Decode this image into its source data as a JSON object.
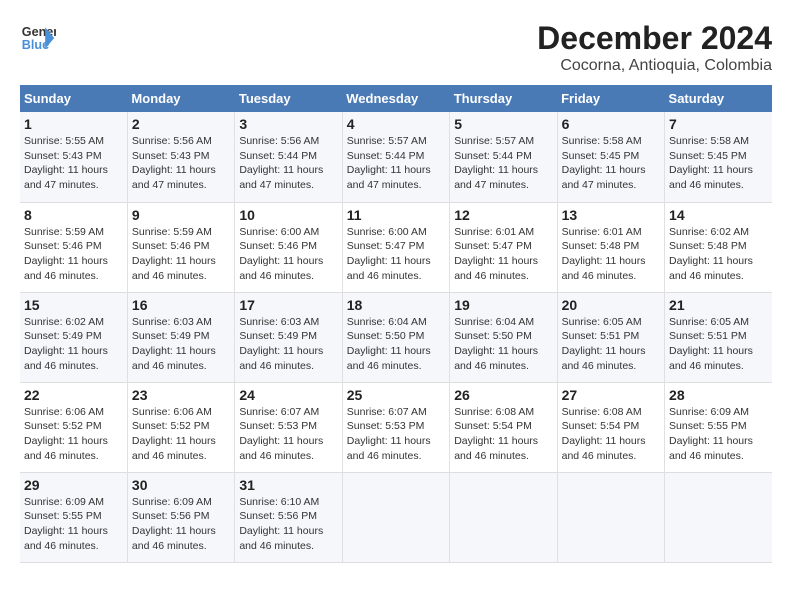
{
  "header": {
    "logo_line1": "General",
    "logo_line2": "Blue",
    "title": "December 2024",
    "subtitle": "Cocorna, Antioquia, Colombia"
  },
  "days_of_week": [
    "Sunday",
    "Monday",
    "Tuesday",
    "Wednesday",
    "Thursday",
    "Friday",
    "Saturday"
  ],
  "weeks": [
    [
      {
        "day": "1",
        "info": "Sunrise: 5:55 AM\nSunset: 5:43 PM\nDaylight: 11 hours and 47 minutes."
      },
      {
        "day": "2",
        "info": "Sunrise: 5:56 AM\nSunset: 5:43 PM\nDaylight: 11 hours and 47 minutes."
      },
      {
        "day": "3",
        "info": "Sunrise: 5:56 AM\nSunset: 5:44 PM\nDaylight: 11 hours and 47 minutes."
      },
      {
        "day": "4",
        "info": "Sunrise: 5:57 AM\nSunset: 5:44 PM\nDaylight: 11 hours and 47 minutes."
      },
      {
        "day": "5",
        "info": "Sunrise: 5:57 AM\nSunset: 5:44 PM\nDaylight: 11 hours and 47 minutes."
      },
      {
        "day": "6",
        "info": "Sunrise: 5:58 AM\nSunset: 5:45 PM\nDaylight: 11 hours and 47 minutes."
      },
      {
        "day": "7",
        "info": "Sunrise: 5:58 AM\nSunset: 5:45 PM\nDaylight: 11 hours and 46 minutes."
      }
    ],
    [
      {
        "day": "8",
        "info": "Sunrise: 5:59 AM\nSunset: 5:46 PM\nDaylight: 11 hours and 46 minutes."
      },
      {
        "day": "9",
        "info": "Sunrise: 5:59 AM\nSunset: 5:46 PM\nDaylight: 11 hours and 46 minutes."
      },
      {
        "day": "10",
        "info": "Sunrise: 6:00 AM\nSunset: 5:46 PM\nDaylight: 11 hours and 46 minutes."
      },
      {
        "day": "11",
        "info": "Sunrise: 6:00 AM\nSunset: 5:47 PM\nDaylight: 11 hours and 46 minutes."
      },
      {
        "day": "12",
        "info": "Sunrise: 6:01 AM\nSunset: 5:47 PM\nDaylight: 11 hours and 46 minutes."
      },
      {
        "day": "13",
        "info": "Sunrise: 6:01 AM\nSunset: 5:48 PM\nDaylight: 11 hours and 46 minutes."
      },
      {
        "day": "14",
        "info": "Sunrise: 6:02 AM\nSunset: 5:48 PM\nDaylight: 11 hours and 46 minutes."
      }
    ],
    [
      {
        "day": "15",
        "info": "Sunrise: 6:02 AM\nSunset: 5:49 PM\nDaylight: 11 hours and 46 minutes."
      },
      {
        "day": "16",
        "info": "Sunrise: 6:03 AM\nSunset: 5:49 PM\nDaylight: 11 hours and 46 minutes."
      },
      {
        "day": "17",
        "info": "Sunrise: 6:03 AM\nSunset: 5:49 PM\nDaylight: 11 hours and 46 minutes."
      },
      {
        "day": "18",
        "info": "Sunrise: 6:04 AM\nSunset: 5:50 PM\nDaylight: 11 hours and 46 minutes."
      },
      {
        "day": "19",
        "info": "Sunrise: 6:04 AM\nSunset: 5:50 PM\nDaylight: 11 hours and 46 minutes."
      },
      {
        "day": "20",
        "info": "Sunrise: 6:05 AM\nSunset: 5:51 PM\nDaylight: 11 hours and 46 minutes."
      },
      {
        "day": "21",
        "info": "Sunrise: 6:05 AM\nSunset: 5:51 PM\nDaylight: 11 hours and 46 minutes."
      }
    ],
    [
      {
        "day": "22",
        "info": "Sunrise: 6:06 AM\nSunset: 5:52 PM\nDaylight: 11 hours and 46 minutes."
      },
      {
        "day": "23",
        "info": "Sunrise: 6:06 AM\nSunset: 5:52 PM\nDaylight: 11 hours and 46 minutes."
      },
      {
        "day": "24",
        "info": "Sunrise: 6:07 AM\nSunset: 5:53 PM\nDaylight: 11 hours and 46 minutes."
      },
      {
        "day": "25",
        "info": "Sunrise: 6:07 AM\nSunset: 5:53 PM\nDaylight: 11 hours and 46 minutes."
      },
      {
        "day": "26",
        "info": "Sunrise: 6:08 AM\nSunset: 5:54 PM\nDaylight: 11 hours and 46 minutes."
      },
      {
        "day": "27",
        "info": "Sunrise: 6:08 AM\nSunset: 5:54 PM\nDaylight: 11 hours and 46 minutes."
      },
      {
        "day": "28",
        "info": "Sunrise: 6:09 AM\nSunset: 5:55 PM\nDaylight: 11 hours and 46 minutes."
      }
    ],
    [
      {
        "day": "29",
        "info": "Sunrise: 6:09 AM\nSunset: 5:55 PM\nDaylight: 11 hours and 46 minutes."
      },
      {
        "day": "30",
        "info": "Sunrise: 6:09 AM\nSunset: 5:56 PM\nDaylight: 11 hours and 46 minutes."
      },
      {
        "day": "31",
        "info": "Sunrise: 6:10 AM\nSunset: 5:56 PM\nDaylight: 11 hours and 46 minutes."
      },
      {
        "day": "",
        "info": ""
      },
      {
        "day": "",
        "info": ""
      },
      {
        "day": "",
        "info": ""
      },
      {
        "day": "",
        "info": ""
      }
    ]
  ]
}
